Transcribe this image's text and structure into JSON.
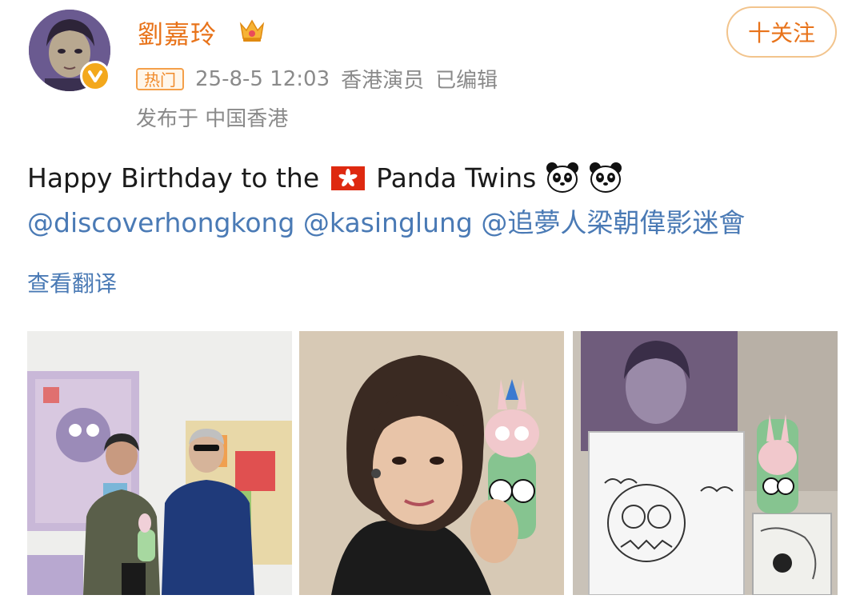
{
  "user": {
    "name": "劉嘉玲",
    "badges": [
      "crown-icon",
      "verified-icon"
    ]
  },
  "follow": {
    "label": "十关注"
  },
  "meta": {
    "hot_label": "热门",
    "timestamp": "25-8-5 12:03",
    "role": "香港演员",
    "edited": "已编辑",
    "location": "发布于 中国香港"
  },
  "post": {
    "text_prefix": "Happy Birthday to the",
    "flag_icon": "hong-kong-flag-icon",
    "text_suffix": "Panda Twins",
    "emoji": [
      "panda-icon",
      "panda-icon"
    ],
    "mentions": [
      "@discoverhongkong",
      "@kasinglung",
      "@追夢人梁朝偉影迷會"
    ]
  },
  "translate_label": "查看翻译",
  "photos": [
    {
      "name": "photo-gallery-two-men"
    },
    {
      "name": "photo-woman-with-figure"
    },
    {
      "name": "photo-portrait-and-sketch"
    }
  ],
  "colors": {
    "accent": "#e8731a",
    "link": "#4a7ab5",
    "meta": "#8a8a8a"
  }
}
